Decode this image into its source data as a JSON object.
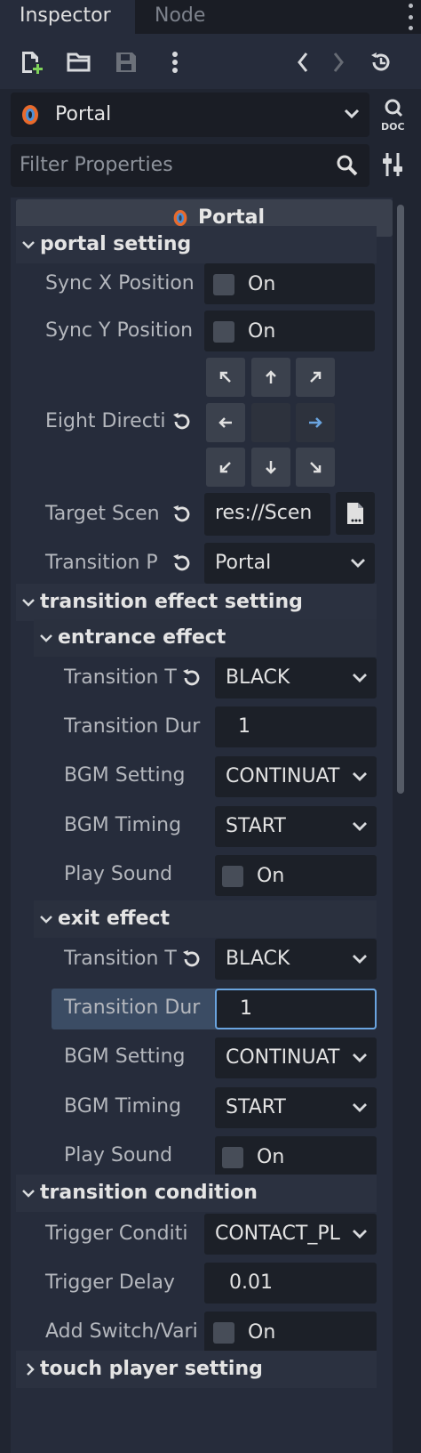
{
  "tabs": {
    "inspector": "Inspector",
    "node": "Node"
  },
  "object": {
    "name": "Portal"
  },
  "filter": {
    "placeholder": "Filter Properties"
  },
  "header": {
    "title": "Portal"
  },
  "sections": {
    "portal_setting": "portal setting",
    "transition_effect_setting": "transition effect setting",
    "entrance_effect": "entrance effect",
    "exit_effect": "exit effect",
    "transition_condition": "transition condition",
    "touch_player_setting": "touch player setting"
  },
  "portal_setting": {
    "sync_x": {
      "label": "Sync X Position",
      "value": "On"
    },
    "sync_y": {
      "label": "Sync Y Position",
      "value": "On"
    },
    "eight_direction": {
      "label": "Eight Directi"
    },
    "target_scene": {
      "label": "Target Scen",
      "value": "res://Scen"
    },
    "transition_p": {
      "label": "Transition P",
      "value": "Portal"
    }
  },
  "entrance": {
    "transition_t": {
      "label": "Transition T",
      "value": "BLACK"
    },
    "transition_dur": {
      "label": "Transition Dur",
      "value": "1"
    },
    "bgm_setting": {
      "label": "BGM Setting",
      "value": "CONTINUAT"
    },
    "bgm_timing": {
      "label": "BGM Timing",
      "value": "START"
    },
    "play_sound": {
      "label": "Play Sound",
      "value": "On"
    }
  },
  "exit": {
    "transition_t": {
      "label": "Transition T",
      "value": "BLACK"
    },
    "transition_dur": {
      "label": "Transition Dur",
      "value": "1"
    },
    "bgm_setting": {
      "label": "BGM Setting",
      "value": "CONTINUAT"
    },
    "bgm_timing": {
      "label": "BGM Timing",
      "value": "START"
    },
    "play_sound": {
      "label": "Play Sound",
      "value": "On"
    }
  },
  "condition": {
    "trigger_condition": {
      "label": "Trigger Conditi",
      "value": "CONTACT_PL"
    },
    "trigger_delay": {
      "label": "Trigger Delay",
      "value": "0.01"
    },
    "add_switch": {
      "label": "Add Switch/Vari",
      "value": "On"
    }
  },
  "colors": {
    "accent": "#6aa4df",
    "panel": "#262c3b",
    "field": "#1c2028",
    "selected_row": "#3b4c64",
    "portal_icon": "#e86a2c"
  }
}
